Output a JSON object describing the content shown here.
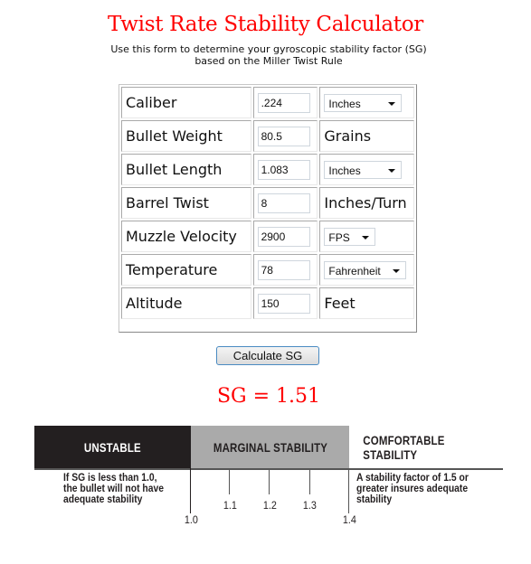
{
  "header": {
    "title": "Twist Rate Stability Calculator",
    "subtitle_line1": "Use this form to determine your gyroscopic stability factor (SG)",
    "subtitle_line2": "based on the Miller Twist Rule"
  },
  "form": {
    "rows": [
      {
        "label": "Caliber",
        "value": ".224",
        "unit_type": "select",
        "unit": "Inches"
      },
      {
        "label": "Bullet Weight",
        "value": "80.5",
        "unit_type": "text",
        "unit": "Grains"
      },
      {
        "label": "Bullet Length",
        "value": "1.083",
        "unit_type": "select",
        "unit": "Inches"
      },
      {
        "label": "Barrel Twist",
        "value": "8",
        "unit_type": "text",
        "unit": "Inches/Turn"
      },
      {
        "label": "Muzzle Velocity",
        "value": "2900",
        "unit_type": "select",
        "unit": "FPS"
      },
      {
        "label": "Temperature",
        "value": "78",
        "unit_type": "select",
        "unit": "Fahrenheit"
      },
      {
        "label": "Altitude",
        "value": "150",
        "unit_type": "text",
        "unit": "Feet"
      }
    ],
    "calculate_label": "Calculate SG"
  },
  "result": {
    "text": "SG = 1.51",
    "value": 1.51
  },
  "stability_scale": {
    "bands": [
      {
        "label": "UNSTABLE",
        "range": [
          null,
          1.0
        ],
        "color": "#231f20"
      },
      {
        "label": "MARGINAL STABILITY",
        "range": [
          1.0,
          1.4
        ],
        "color": "#aaaaaa"
      },
      {
        "label": "COMFORTABLE STABILITY",
        "range": [
          1.4,
          null
        ],
        "color": "#ffffff"
      }
    ],
    "ticks": [
      "1.0",
      "1.1",
      "1.2",
      "1.3",
      "1.4"
    ],
    "unstable_note": [
      "If SG is less than 1.0,",
      "the bullet will not have",
      "adequate stability"
    ],
    "comfortable_note": [
      "A stability factor of 1.5 or",
      "greater insures adequate",
      "stability"
    ]
  },
  "colors": {
    "title": "#ff0000",
    "result": "#ff0000",
    "button_border": "#4a8bc2"
  }
}
